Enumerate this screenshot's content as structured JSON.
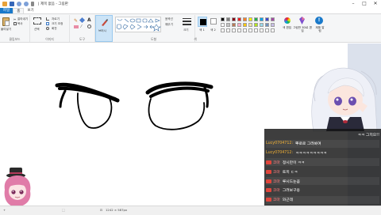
{
  "window": {
    "title": "| 제목 없음 - 그림판",
    "controls": [
      "–",
      "□",
      "✕"
    ]
  },
  "tabs": [
    {
      "label": "파일"
    },
    {
      "label": "홈"
    },
    {
      "label": "보기"
    }
  ],
  "ribbon": {
    "clipboard": {
      "group_label": "클립보드",
      "paste_label": "붙여넣기",
      "cut_label": "잘라내기",
      "copy_label": "복사"
    },
    "image": {
      "group_label": "이미지",
      "select_label": "선택",
      "crop_label": "자르기",
      "resize_label": "크기 조정",
      "rotate_label": "회전"
    },
    "tools": {
      "group_label": "도구"
    },
    "brushes": {
      "label": "브러시"
    },
    "shapes": {
      "group_label": "도형",
      "outline_label": "윤곽선",
      "fill_label": "채우기"
    },
    "size": {
      "label": "크기"
    },
    "colors": {
      "group_label": "색",
      "color1_label": "색 1",
      "color2_label": "색 2",
      "edit_label": "색 편집",
      "paint3d_label": "그림판 3D로 편집",
      "product_alert_label": "제품 알림",
      "palette": [
        "#000000",
        "#7f7f7f",
        "#880015",
        "#ed1c24",
        "#ff7f27",
        "#fff200",
        "#22b14c",
        "#00a2e8",
        "#3f48cc",
        "#a349a4",
        "#ffffff",
        "#c3c3c3",
        "#b97a57",
        "#ffaec9",
        "#ffc90e",
        "#efe4b0",
        "#b5e61d",
        "#99d9ea",
        "#7092be",
        "#c8bfe7"
      ]
    }
  },
  "status": {
    "dimensions": "1242 × 587px"
  },
  "chat": {
    "messages": [
      {
        "name": "",
        "text": "ㅋㅋ 그치으!!",
        "type": "plain"
      },
      {
        "name": "Lucy0704712:",
        "text": "뿌로로 그려봐여",
        "type": "user"
      },
      {
        "name": "Lucy0704712:",
        "text": "ㅋㅋㅋㅋㅋㅋㅋㅋㅋ",
        "type": "user"
      },
      {
        "name": "코마",
        "text": "정시만이 ㅋㅋ",
        "type": "badge"
      },
      {
        "name": "코마",
        "text": "토끼 ㄷㅋ",
        "type": "badge"
      },
      {
        "name": "코마",
        "text": "루시드눈꼼",
        "type": "badge"
      },
      {
        "name": "코마",
        "text": "그려보구웅",
        "type": "badge"
      },
      {
        "name": "코마",
        "text": "와근데",
        "type": "badge"
      },
      {
        "name": "코마",
        "text": "루눈도 어려운디",
        "type": "badge"
      }
    ]
  }
}
